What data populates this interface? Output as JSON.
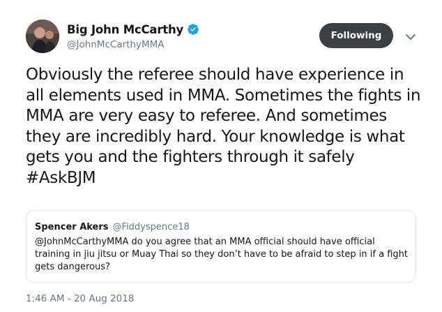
{
  "author": {
    "display_name": "Big John McCarthy",
    "handle": "@JohnMcCarthyMMA",
    "verified_icon": "verified-badge-icon",
    "avatar_icon": "profile-photo"
  },
  "actions": {
    "follow_label": "Following",
    "menu_icon": "chevron-down-icon"
  },
  "tweet": {
    "text": "Obviously the referee should have experience in all elements used in MMA. Sometimes the fights in MMA are very easy to referee. And sometimes they are incredibly hard. Your knowledge is what gets you and the fighters through it safely ",
    "hashtag": "#AskBJM",
    "timestamp": "1:46 AM - 20 Aug 2018"
  },
  "quoted_tweet": {
    "display_name": "Spencer Akers",
    "handle": "@Fiddyspence18",
    "text": "@JohnMcCarthyMMA do you agree that an MMA official should have official training in jiu jitsu or Muay Thai  so they don’t have to be afraid to step in if a fight gets dangerous?"
  },
  "colors": {
    "follow_button_bg": "#3d4042",
    "verified_blue": "#1da1f2",
    "secondary_text": "#657786",
    "border": "#e1e8ed"
  }
}
